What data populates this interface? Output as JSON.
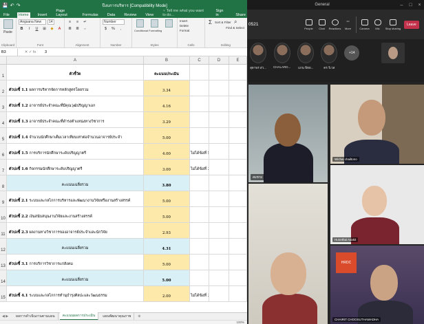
{
  "excel": {
    "title_bar": {
      "filename": "ปีงบการบริหาร [Compatibility Mode]",
      "qat": [
        "💾",
        "↶",
        "↷"
      ]
    },
    "tabs": [
      "File",
      "Home",
      "Insert",
      "Page Layout",
      "Formulas",
      "Data",
      "Review",
      "View"
    ],
    "active_tab": "Home",
    "tell_me": "♀ Tell me what you want to do...",
    "signin": "Sign in",
    "share": "Share",
    "ribbon": {
      "clipboard_label": "Clipboard",
      "paste_label": "Paste",
      "font_label": "Font",
      "font_name": "Angsana New",
      "font_size": "14",
      "alignment_label": "Alignment",
      "number_label": "Number",
      "number_format": "Number",
      "styles_label": "Styles",
      "conditional_label": "Conditional Formatting",
      "format_table_label": "Format as Table",
      "cell_styles_label": "Cell Styles",
      "cells_label": "Cells",
      "insert_label": "Insert",
      "delete_label": "Delete",
      "format_label": "Format",
      "editing_label": "Editing",
      "sort_label": "Sort & Filter",
      "find_label": "Find & Select"
    },
    "formula_bar": {
      "name_box": "B3",
      "fx": "✕ ✓ fx",
      "value": "3"
    },
    "columns": [
      "A",
      "B",
      "C",
      "D",
      "E"
    ],
    "rows": [
      {
        "n": "1",
        "type": "hdr",
        "a_bold": "",
        "a": "ตัวชี้วัด",
        "b": "คะแนนประเมิน",
        "c": "",
        "d": ""
      },
      {
        "n": "2",
        "type": "item",
        "a_bold": "ตัวบ่งชี้ 1.1",
        "a": "ผลการบริหารจัดการหลักสูตรโดยรวม",
        "b": "3.34",
        "c": "",
        "d": ""
      },
      {
        "n": "3",
        "type": "item",
        "a_bold": "ตัวบ่งชี้ 1.2",
        "a": "อาจารย์ประจำคณะที่มีคุณวุฒิปริญญาเอก",
        "b": "4.16",
        "c": "",
        "d": ""
      },
      {
        "n": "4",
        "type": "item",
        "a_bold": "ตัวบ่งชี้ 1.3",
        "a": "อาจารย์ประจำคณะที่ดำรงตำแหน่งทางวิชาการ",
        "b": "3.29",
        "c": "",
        "d": ""
      },
      {
        "n": "5",
        "type": "item",
        "a_bold": "ตัวบ่งชี้ 1.4",
        "a": "จำนวนนักศึกษาเต็มเวลาเทียบเท่าต่อจำนวนอาจารย์ประจำ",
        "b": "5.00",
        "c": "",
        "d": ""
      },
      {
        "n": "6",
        "type": "item",
        "a_bold": "ตัวบ่งชี้ 1.5",
        "a": "การบริการนักศึกษาระดับปริญญาตรี",
        "b": "4.00",
        "c": "ไม่ได้ข้อที่ 5",
        "d": ""
      },
      {
        "n": "7",
        "type": "item",
        "a_bold": "ตัวบ่งชี้ 1.6",
        "a": "กิจกรรมนักศึกษาระดับปริญญาตรี",
        "b": "3.00",
        "c": "ไม่ได้ข้อที่ 3,5,6",
        "d": ""
      },
      {
        "n": "8",
        "type": "avg",
        "a_bold": "",
        "a": "คะแนนเฉลี่ยรวม",
        "b": "3.80",
        "c": "",
        "d": ""
      },
      {
        "n": "9",
        "type": "item",
        "a_bold": "ตัวบ่งชี้ 2.1",
        "a": "ระบบและกลไกการบริหารและพัฒนางานวิจัยหรืองานสร้างสรรค์",
        "b": "5.00",
        "c": "",
        "d": ""
      },
      {
        "n": "10",
        "type": "item",
        "a_bold": "ตัวบ่งชี้ 2.2",
        "a": "เงินสนับสนุนงานวิจัยและงานสร้างสรรค์",
        "b": "5.00",
        "c": "",
        "d": ""
      },
      {
        "n": "11",
        "type": "item",
        "a_bold": "ตัวบ่งชี้ 2.3",
        "a": "ผลงานทางวิชาการของอาจารย์ประจำและนักวิจัย",
        "b": "2.93",
        "c": "",
        "d": ""
      },
      {
        "n": "12",
        "type": "avg",
        "a_bold": "",
        "a": "คะแนนเฉลี่ยรวม",
        "b": "4.31",
        "c": "",
        "d": ""
      },
      {
        "n": "13",
        "type": "item",
        "a_bold": "ตัวบ่งชี้ 3.1",
        "a": "การบริการวิชาการแก่สังคม",
        "b": "5.00",
        "c": "",
        "d": ""
      },
      {
        "n": "14",
        "type": "avg",
        "a_bold": "",
        "a": "คะแนนเฉลี่ยรวม",
        "b": "5.00",
        "c": "",
        "d": ""
      },
      {
        "n": "15",
        "type": "item",
        "a_bold": "ตัวบ่งชี้ 4.1",
        "a": "ระบบและกลไกการทำนุบำรุงศิลปะและวัฒนธรรม",
        "b": "2.00",
        "c": "ไม่ได้ข้อที่ 3,4,5,6,7",
        "d": ""
      }
    ],
    "sheet_tabs": [
      "ผลการดำเนินงานตามแผน",
      "คะแนนผลการประเมิน",
      "แผนพัฒนาคุณภาพ"
    ],
    "active_sheet": 1,
    "sheet_nav": "◀ ▶",
    "add_sheet": "⊕",
    "status_zoom": "100%"
  },
  "meeting": {
    "title": "General",
    "time": "0521",
    "buttons": [
      "People",
      "Chat",
      "Reactions",
      "More",
      "Camera",
      "Mic",
      "Stop sharing"
    ],
    "leave_label": "Leave",
    "strip": [
      {
        "name": "สุดาพร ส่ว..."
      },
      {
        "name": "CHALARD..."
      },
      {
        "name": "แกน พิทย..."
      },
      {
        "name": "ดร.วีเวส"
      }
    ],
    "more_count": "+14",
    "tiles": [
      {
        "name": "สมชาย"
      },
      {
        "name": "Wichai chailtono"
      },
      {
        "name": "Hunethai Avakit"
      },
      {
        "name": ""
      },
      {
        "name": "CHAIRIT CHOOSUTHAMADHA"
      }
    ],
    "logo_text": "HRDC"
  }
}
